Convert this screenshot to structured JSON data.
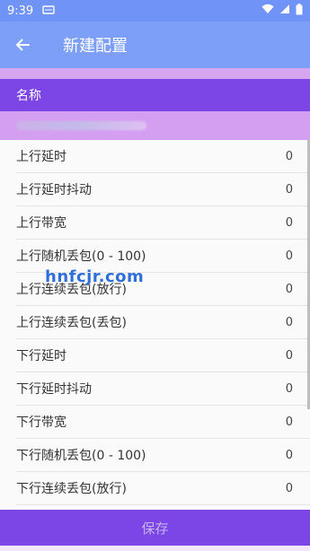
{
  "status_bar": {
    "time": "9:39",
    "notification_icon": "cast-icon",
    "wifi_icon": "wifi-icon",
    "signal_icon": "signal-icon",
    "battery_icon": "battery-icon"
  },
  "app_bar": {
    "back_icon": "arrow-left-icon",
    "title": "新建配置"
  },
  "name_section": {
    "label": "名称"
  },
  "settings": [
    {
      "label": "上行延时",
      "value": "0"
    },
    {
      "label": "上行延时抖动",
      "value": "0"
    },
    {
      "label": "上行带宽",
      "value": "0"
    },
    {
      "label": "上行随机丢包(0 - 100)",
      "value": "0"
    },
    {
      "label": "上行连续丢包(放行)",
      "value": "0"
    },
    {
      "label": "上行连续丢包(丢包)",
      "value": "0"
    },
    {
      "label": "下行延时",
      "value": "0"
    },
    {
      "label": "下行延时抖动",
      "value": "0"
    },
    {
      "label": "下行带宽",
      "value": "0"
    },
    {
      "label": "下行随机丢包(0 - 100)",
      "value": "0"
    },
    {
      "label": "下行连续丢包(放行)",
      "value": "0"
    }
  ],
  "watermark": "hnfcjr.com",
  "save_label": "保存",
  "colors": {
    "status_bar": "#6f93f7",
    "app_bar": "#7d9ff8",
    "accent_purple": "#7c45e6",
    "light_purple": "#d59ff1"
  }
}
